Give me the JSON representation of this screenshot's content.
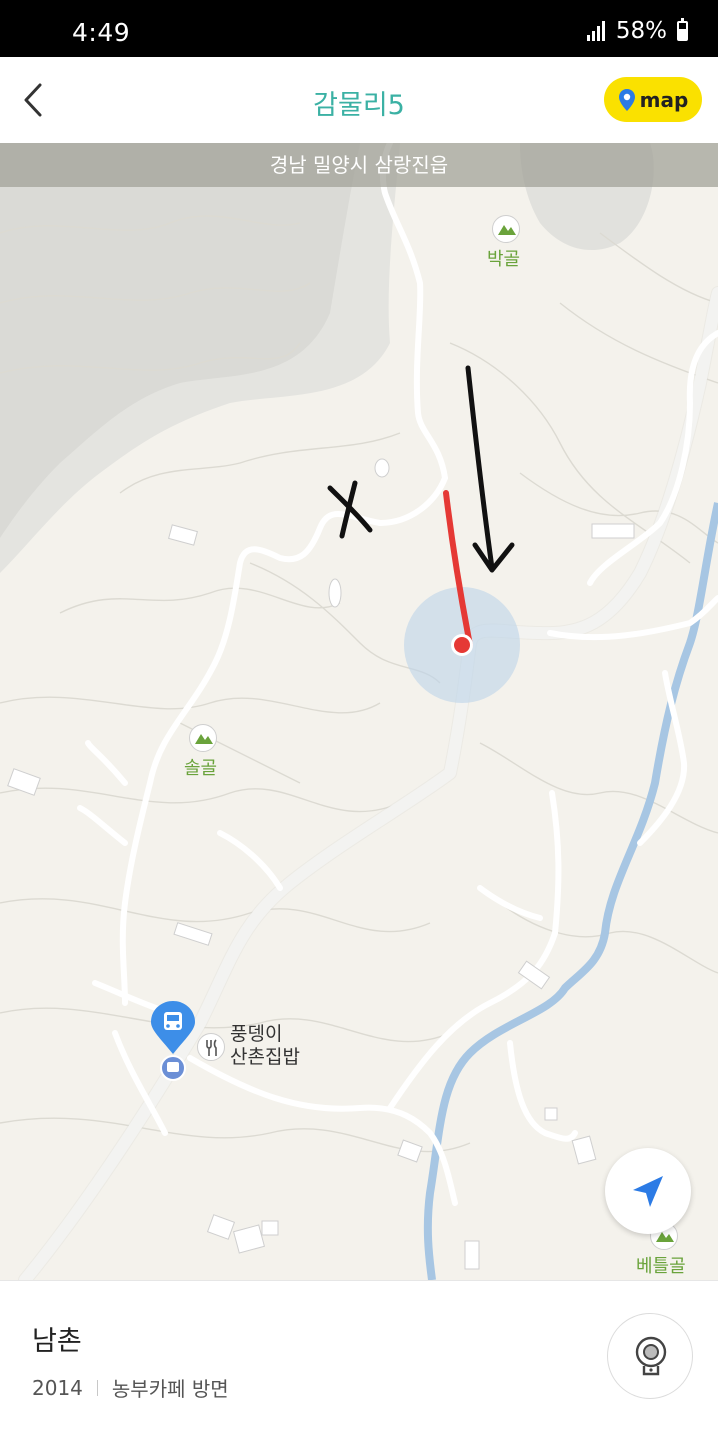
{
  "status_bar": {
    "time": "4:49",
    "battery": "58%"
  },
  "header": {
    "title": "감물리5",
    "map_button_label": "map"
  },
  "map": {
    "region_label": "경남 밀양시 삼랑진읍",
    "places": {
      "bakgol": "박골",
      "solgol": "솔골",
      "betulgol": "베틀골",
      "restaurant_line1": "풍뎅이",
      "restaurant_line2": "산촌집밥"
    },
    "icons": [
      "mountain-icon",
      "bus-stop-icon",
      "restaurant-icon",
      "location-arrow-icon",
      "map-pin-icon"
    ],
    "colors": {
      "current_location": "#e53935",
      "river": "#a7c6e3",
      "accent": "#3bb1a4",
      "map_button": "#fae100"
    }
  },
  "place": {
    "name": "남촌",
    "year": "2014",
    "nearby": "농부카페 방면"
  }
}
